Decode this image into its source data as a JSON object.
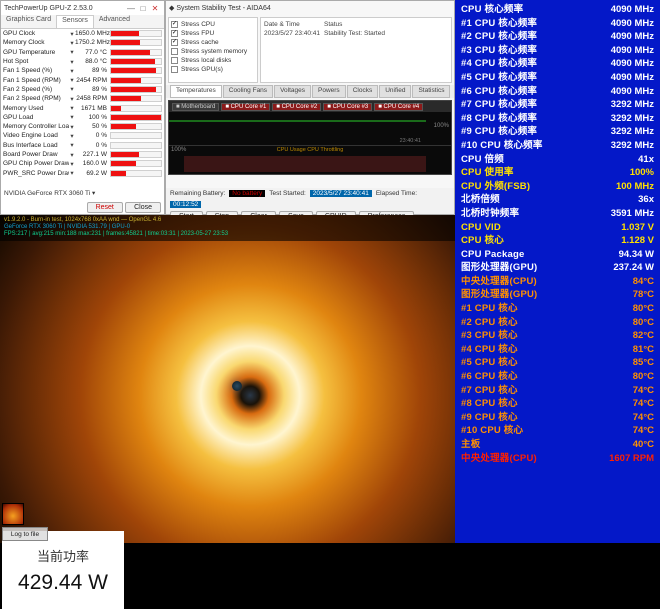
{
  "gpuz": {
    "title": "TechPowerUp GPU-Z 2.53.0",
    "tabs": {
      "graphics": "Graphics Card",
      "sensors": "Sensors",
      "adv": "Advanced"
    },
    "sensors": [
      {
        "name": "GPU Clock",
        "value": "1650.0 MHz",
        "pct": 55
      },
      {
        "name": "Memory Clock",
        "value": "1750.2 MHz",
        "pct": 58
      },
      {
        "name": "GPU Temperature",
        "value": "77.0 °C",
        "pct": 77
      },
      {
        "name": "Hot Spot",
        "value": "88.0 °C",
        "pct": 88
      },
      {
        "name": "Fan 1 Speed (%)",
        "value": "89 %",
        "pct": 89
      },
      {
        "name": "Fan 1 Speed (RPM)",
        "value": "2454 RPM",
        "pct": 60
      },
      {
        "name": "Fan 2 Speed (%)",
        "value": "89 %",
        "pct": 89
      },
      {
        "name": "Fan 2 Speed (RPM)",
        "value": "2458 RPM",
        "pct": 60
      },
      {
        "name": "Memory Used",
        "value": "1671 MB",
        "pct": 20
      },
      {
        "name": "GPU Load",
        "value": "100 %",
        "pct": 100
      },
      {
        "name": "Memory Controller Load",
        "value": "50 %",
        "pct": 50
      },
      {
        "name": "Video Engine Load",
        "value": "0 %",
        "pct": 0
      },
      {
        "name": "Bus Interface Load",
        "value": "0 %",
        "pct": 0
      },
      {
        "name": "Board Power Draw",
        "value": "227.1 W",
        "pct": 55
      },
      {
        "name": "GPU Chip Power Draw",
        "value": "160.0 W",
        "pct": 50
      },
      {
        "name": "PWR_SRC Power Draw",
        "value": "69.2 W",
        "pct": 30
      }
    ],
    "gpu_name": "NVIDIA GeForce RTX 3060 Ti",
    "reset": "Reset",
    "close": "Close"
  },
  "aida": {
    "title": "System Stability Test - AIDA64",
    "tree": [
      {
        "label": "Stress CPU",
        "checked": true
      },
      {
        "label": "Stress FPU",
        "checked": true
      },
      {
        "label": "Stress cache",
        "checked": true
      },
      {
        "label": "Stress system memory",
        "checked": false
      },
      {
        "label": "Stress local disks",
        "checked": false
      },
      {
        "label": "Stress GPU(s)",
        "checked": false
      }
    ],
    "info": {
      "date_lbl": "Date & Time",
      "date_val": "2023/5/27 23:40:41",
      "status_lbl": "Status",
      "status_val": "Stability Test: Started"
    },
    "tabs": [
      "Temperatures",
      "Cooling Fans",
      "Voltages",
      "Powers",
      "Clocks",
      "Unified",
      "Statistics"
    ],
    "chart_cores": [
      "Motherboard",
      "CPU Core #1",
      "CPU Core #2",
      "CPU Core #3",
      "CPU Core #4"
    ],
    "chart1_pct": "100%",
    "chart1_time": "23:40:41",
    "chart2_pct": "100%",
    "chart2_legend": "CPU Usage    CPU Throttling",
    "battery_lbl": "Remaining Battery:",
    "battery_val": "No battery",
    "teststart_lbl": "Test Started:",
    "teststart_val": "2023/5/27 23:40:41",
    "elapsed_lbl": "Elapsed Time:",
    "elapsed_val": "00:12:52",
    "buttons": {
      "start": "Start",
      "stop": "Stop",
      "clear": "Clear",
      "save": "Save",
      "cpuid": "CPUID",
      "prefs": "Preferences"
    }
  },
  "furmark": {
    "line1": "v1.9.2.0 - Burn-in test, 1024x768 0xAA wnd — OpenGL 4.6",
    "line2": "GeForce RTX 3060 Ti | NVIDIA 531.79 | GPU-0",
    "line3": "FPS:217 | avg:215 min:188 max:231 | frames:45821 | time:03:31 | 2023-05-27 23:53",
    "power_label": "当前功率",
    "power_value": "429.44 W",
    "log_btn": "Log to file"
  },
  "hwpanel": [
    {
      "k": "CPU 核心频率",
      "v": "4090 MHz"
    },
    {
      "k": "#1 CPU 核心频率",
      "v": "4090 MHz"
    },
    {
      "k": "#2 CPU 核心频率",
      "v": "4090 MHz"
    },
    {
      "k": "#3 CPU 核心频率",
      "v": "4090 MHz"
    },
    {
      "k": "#4 CPU 核心频率",
      "v": "4090 MHz"
    },
    {
      "k": "#5 CPU 核心频率",
      "v": "4090 MHz"
    },
    {
      "k": "#6 CPU 核心频率",
      "v": "4090 MHz"
    },
    {
      "k": "#7 CPU 核心频率",
      "v": "3292 MHz"
    },
    {
      "k": "#8 CPU 核心频率",
      "v": "3292 MHz"
    },
    {
      "k": "#9 CPU 核心频率",
      "v": "3292 MHz"
    },
    {
      "k": "#10 CPU 核心频率",
      "v": "3292 MHz"
    },
    {
      "k": "CPU 倍频",
      "v": "41x"
    },
    {
      "k": "CPU 使用率",
      "v": "100%",
      "cls": "yel"
    },
    {
      "k": "CPU 外频(FSB)",
      "v": "100 MHz",
      "cls": "yel"
    },
    {
      "k": "北桥倍频",
      "v": "36x"
    },
    {
      "k": "北桥时钟频率",
      "v": "3591 MHz"
    },
    {
      "k": "CPU VID",
      "v": "1.037 V",
      "cls": "yel"
    },
    {
      "k": "CPU 核心",
      "v": "1.128 V",
      "cls": "yel"
    },
    {
      "k": "CPU Package",
      "v": "94.34 W"
    },
    {
      "k": "图形处理器(GPU)",
      "v": "237.24 W"
    },
    {
      "k": "中央处理器(CPU)",
      "v": "84°C",
      "cls": "orn"
    },
    {
      "k": "图形处理器(GPU)",
      "v": "78°C",
      "cls": "orn"
    },
    {
      "k": "#1 CPU 核心",
      "v": "80°C",
      "cls": "orn"
    },
    {
      "k": "#2 CPU 核心",
      "v": "80°C",
      "cls": "orn"
    },
    {
      "k": "#3 CPU 核心",
      "v": "82°C",
      "cls": "orn"
    },
    {
      "k": "#4 CPU 核心",
      "v": "81°C",
      "cls": "orn"
    },
    {
      "k": "#5 CPU 核心",
      "v": "85°C",
      "cls": "orn"
    },
    {
      "k": "#6 CPU 核心",
      "v": "80°C",
      "cls": "orn"
    },
    {
      "k": "#7 CPU 核心",
      "v": "74°C",
      "cls": "orn"
    },
    {
      "k": "#8 CPU 核心",
      "v": "74°C",
      "cls": "orn"
    },
    {
      "k": "#9 CPU 核心",
      "v": "74°C",
      "cls": "orn"
    },
    {
      "k": "#10 CPU 核心",
      "v": "74°C",
      "cls": "orn"
    },
    {
      "k": "主板",
      "v": "40°C",
      "cls": "orn"
    },
    {
      "k": "中央处理器(CPU)",
      "v": "1607 RPM",
      "cls": "red"
    }
  ]
}
